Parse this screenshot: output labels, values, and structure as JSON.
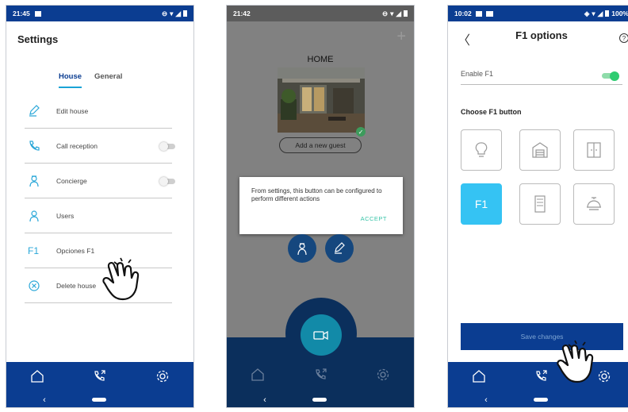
{
  "phone1": {
    "status_time": "21:45",
    "title": "Settings",
    "tabs": [
      "House",
      "General"
    ],
    "rows": [
      {
        "label": "Edit house",
        "icon": "edit-icon"
      },
      {
        "label": "Call reception",
        "icon": "phone-icon",
        "toggle": "off"
      },
      {
        "label": "Concierge",
        "icon": "concierge-icon",
        "toggle": "off"
      },
      {
        "label": "Users",
        "icon": "user-icon"
      },
      {
        "label": "Opciones F1",
        "icon": "f1-icon",
        "icon_text": "F1"
      },
      {
        "label": "Delete house",
        "icon": "delete-icon"
      }
    ]
  },
  "phone2": {
    "status_time": "21:42",
    "home_title": "HOME",
    "add_guest": "Add a new guest",
    "dialog_message": "From settings, this button can be configured to perform different actions",
    "dialog_action": "ACCEPT"
  },
  "phone3": {
    "status_time": "10:02",
    "status_battery": "100%",
    "title": "F1 options",
    "help": "?",
    "enable_label": "Enable F1",
    "enable_on": true,
    "choose_label": "Choose F1 button",
    "selected_tile": "F1",
    "save_label": "Save changes"
  },
  "colors": {
    "primary": "#0b3d91",
    "accent": "#35c3f3",
    "toggle_on": "#2ecc71",
    "accept": "#38c4a8"
  }
}
